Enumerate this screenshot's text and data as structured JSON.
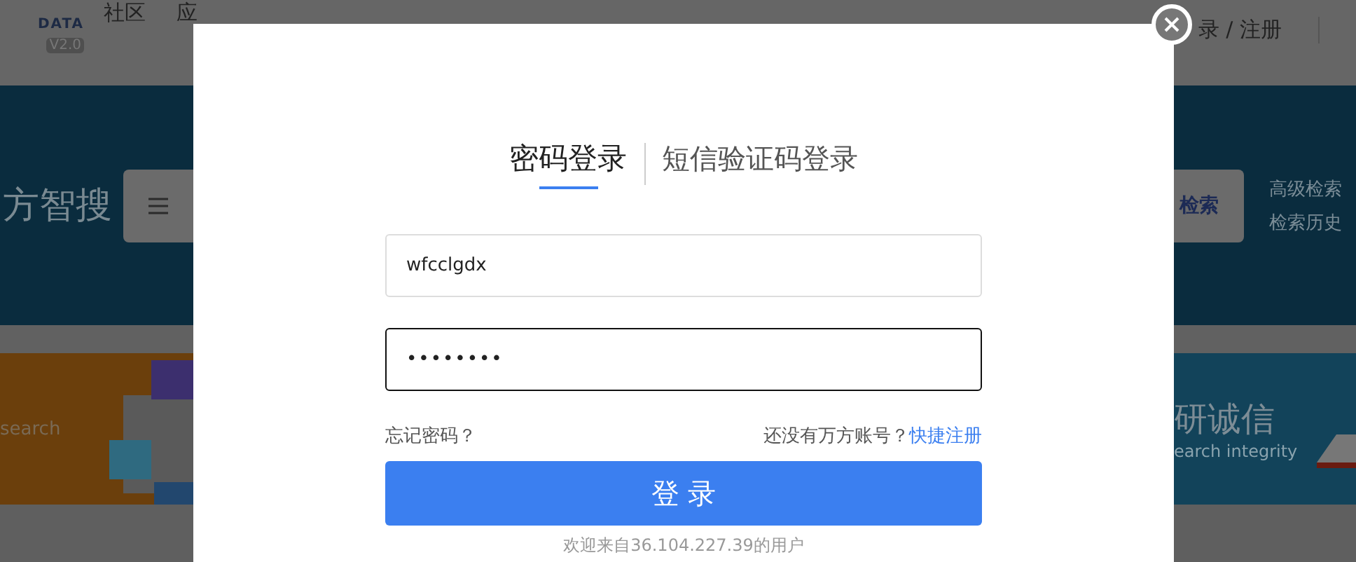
{
  "background": {
    "logo": {
      "subtitle": "DATA",
      "version": "V2.0"
    },
    "nav": [
      "社区",
      "应"
    ],
    "auth": "录 / 注册",
    "hero": {
      "title": "方智搜",
      "search_button": "检索",
      "links": [
        "高级检索",
        "检索历史"
      ]
    },
    "banners": [
      {
        "kind": "cubes",
        "subtitle": "search"
      },
      {
        "kind": "book",
        "title": "研诚信",
        "subtitle": "earch integrity"
      }
    ]
  },
  "modal": {
    "tabs": [
      {
        "label": "密码登录",
        "selected": true
      },
      {
        "label": "短信验证码登录",
        "selected": false
      }
    ],
    "username": {
      "value": "wfcclgdx"
    },
    "password": {
      "value": "••••••••"
    },
    "forgot": "忘记密码？",
    "signup_prompt": "还没有万方账号？",
    "signup_link": "快捷注册",
    "submit": "登 录",
    "welcome": "欢迎来自36.104.227.39的用户"
  }
}
